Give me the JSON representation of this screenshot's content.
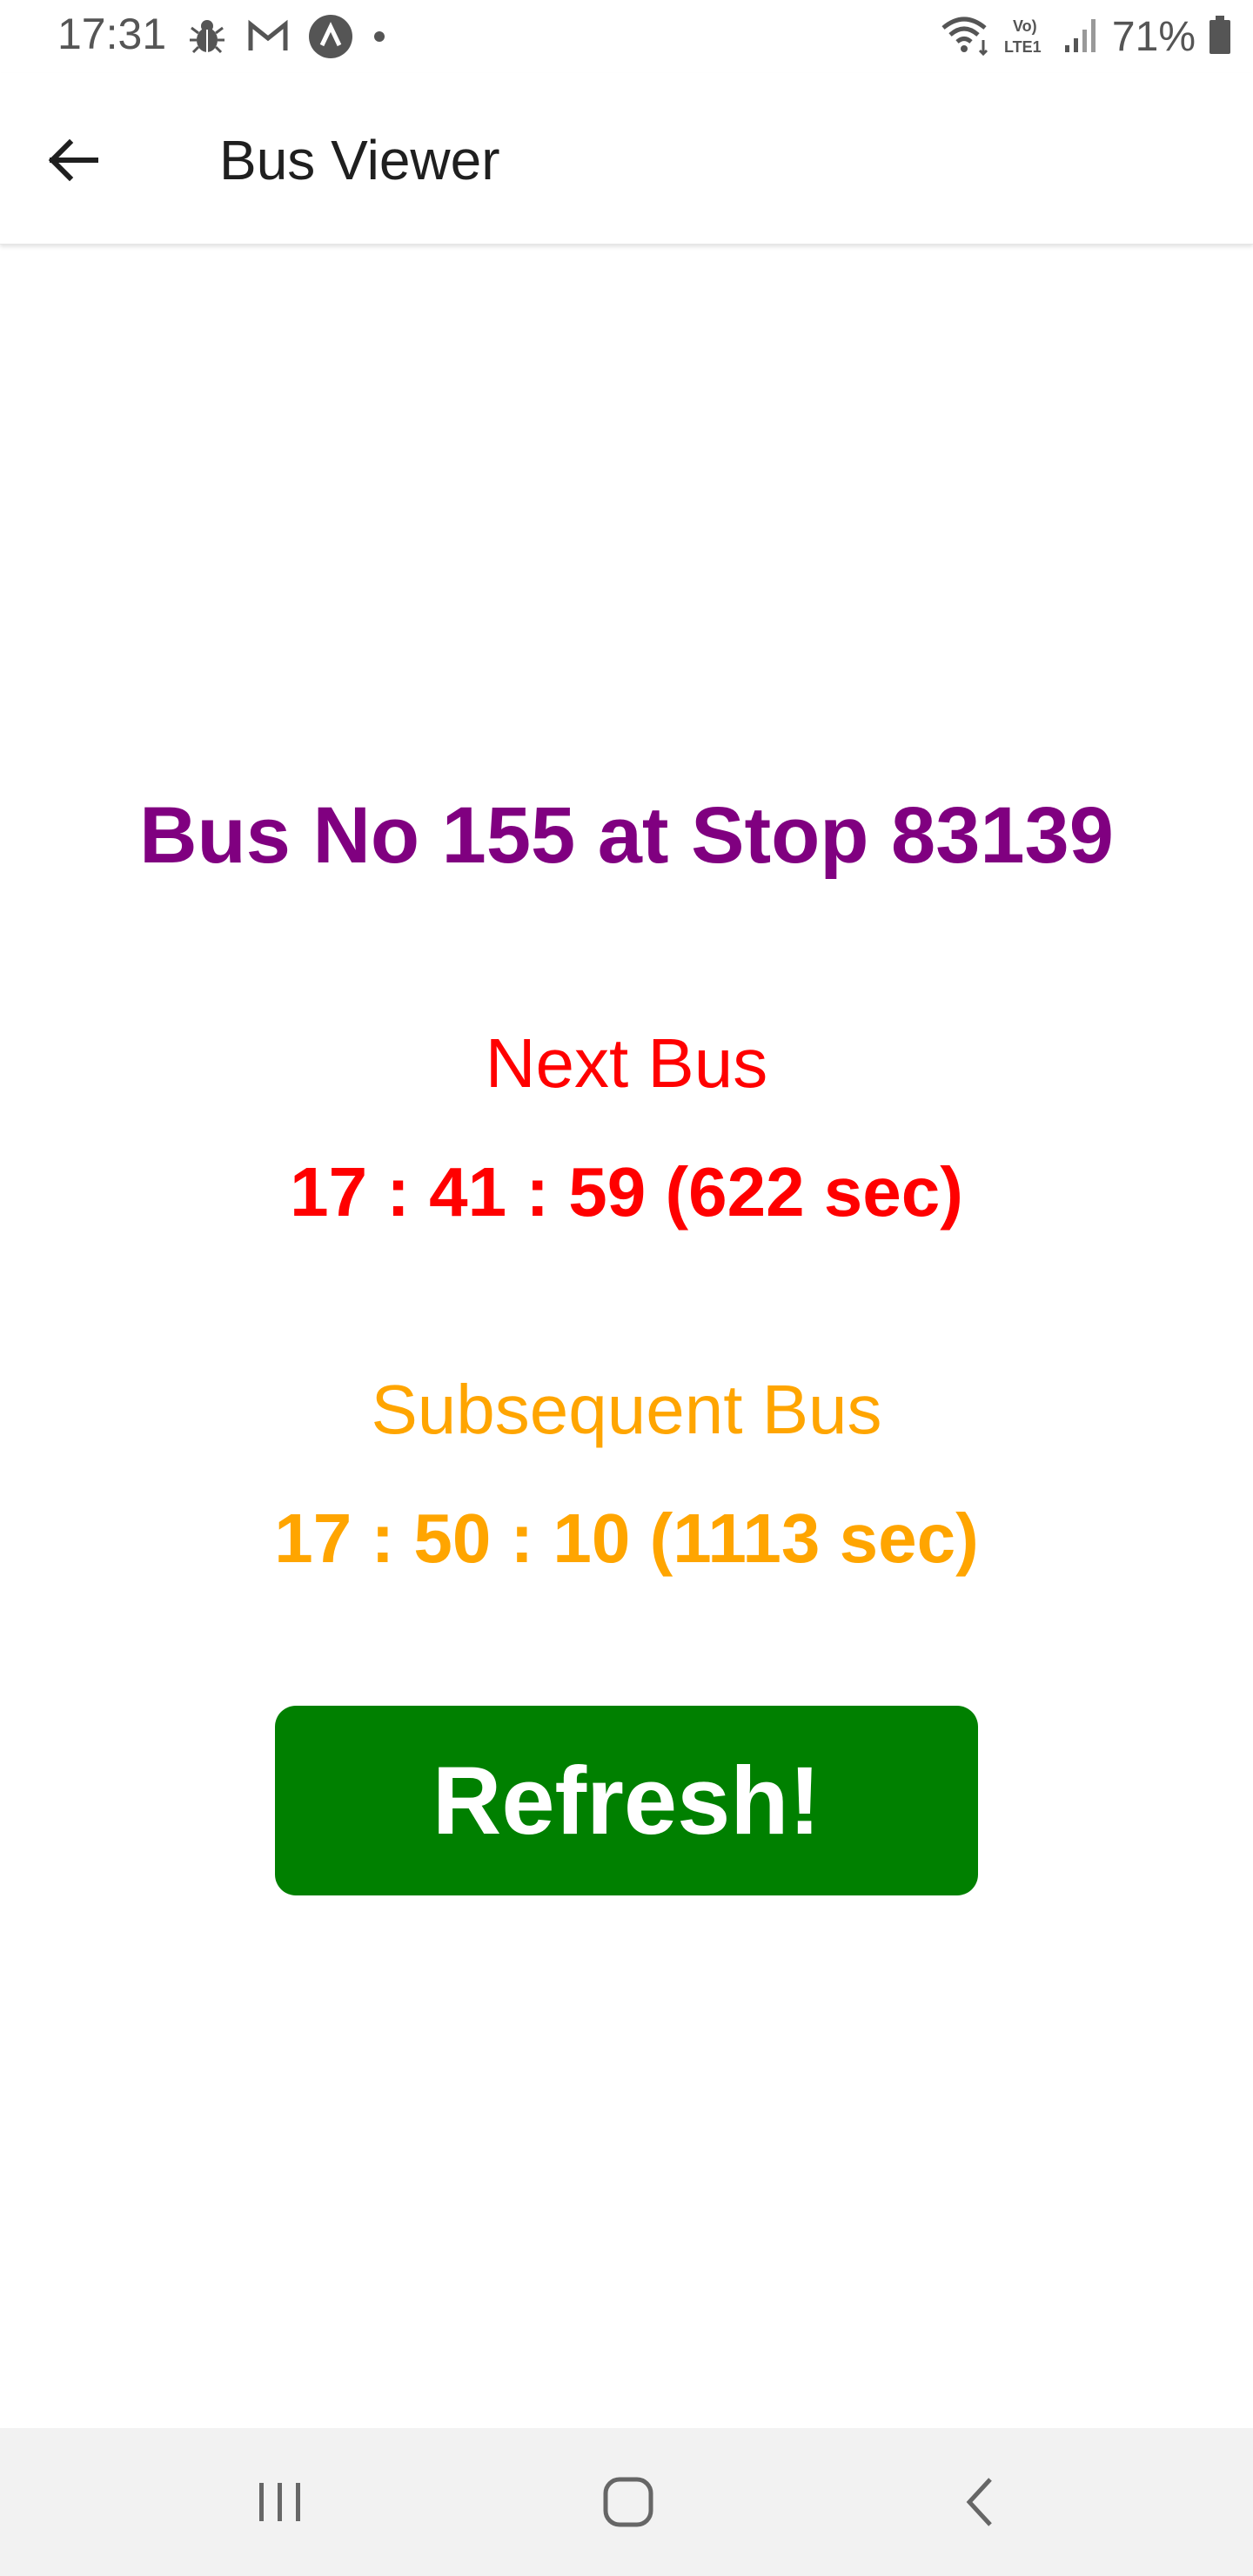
{
  "status_bar": {
    "time": "17:31",
    "battery": "71%",
    "left_icons": [
      "bug-icon",
      "gmail-icon",
      "triangle-app-icon",
      "dot-icon"
    ],
    "right_icons": [
      "wifi-icon",
      "volte-icon",
      "signal-icon",
      "battery-icon"
    ]
  },
  "app_bar": {
    "title": "Bus Viewer",
    "back_icon": "arrow-left-icon"
  },
  "main": {
    "heading": "Bus No 155 at Stop 83139",
    "next_bus_label": "Next Bus",
    "next_bus_time": "17 : 41 : 59 (622 sec)",
    "subsequent_bus_label": "Subsequent Bus",
    "subsequent_bus_time": "17 : 50 : 10 (1113 sec)",
    "refresh_label": "Refresh!"
  },
  "nav_bar": {
    "recents_icon": "recents-icon",
    "home_icon": "home-icon",
    "back_icon": "back-chevron-icon"
  },
  "colors": {
    "heading": "#800080",
    "next_bus": "#ff0000",
    "subsequent_bus": "#ffa500",
    "refresh_button": "#008000",
    "refresh_text": "#ffffff",
    "nav_bar_bg": "#f2f2f2"
  }
}
